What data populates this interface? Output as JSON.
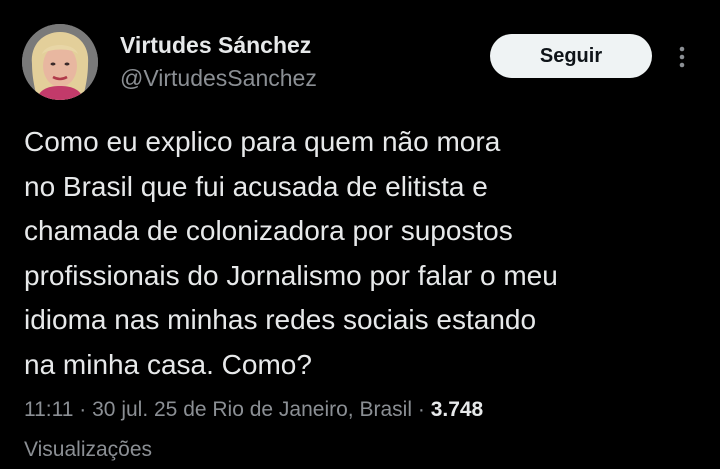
{
  "author": {
    "display_name": "Virtudes Sánchez",
    "handle": "@VirtudesSanchez",
    "avatar": "avatar-photo"
  },
  "actions": {
    "follow_label": "Seguir",
    "more_icon": "more-vertical-icon"
  },
  "tweet": {
    "lines": [
      "Como eu explico para quem não mora",
      "no Brasil que fui acusada de elitista e",
      "chamada de colonizadora por supostos",
      "profissionais do Jornalismo por falar o meu",
      "idioma nas minhas redes sociais estando",
      "na minha casa. Como?"
    ]
  },
  "meta": {
    "time": "11:11",
    "date": "30 jul. 25",
    "location": "de Rio de Janeiro, Brasil",
    "separator": "·",
    "views_count": "3.748",
    "views_label": "Visualizações"
  },
  "colors": {
    "background": "#000000",
    "primary_text": "#e7e9ea",
    "secondary_text": "#8b8f94",
    "button_bg": "#eff3f4",
    "button_text": "#0f1419"
  }
}
